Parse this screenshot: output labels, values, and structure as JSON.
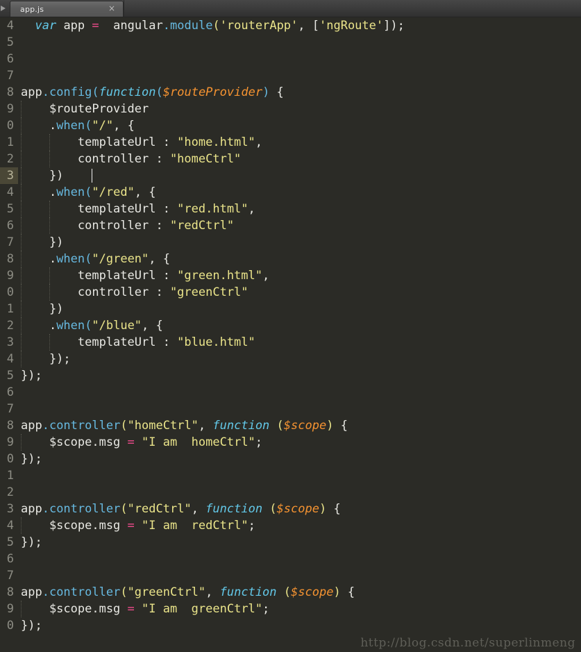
{
  "window": {
    "title": "app.js",
    "theme": "dark-monokai-like"
  },
  "tab_bar": {
    "scroll_left_icon": "triangle-left-icon",
    "tabs": [
      {
        "label": "app.js",
        "close_icon": "close-icon",
        "active": true
      }
    ]
  },
  "colors": {
    "background": "#2b2b26",
    "gutter_text": "#8d8d84",
    "current_line_gutter_bg": "#4a4736",
    "keyword": "#63c8e8",
    "method": "#67b9e0",
    "string": "#eae48a",
    "operator": "#ef4b8c",
    "variable": "#f59331",
    "plain": "#e8e8e3",
    "indent_guide": "#55554c",
    "tab_active_bg": "#5b5b5b",
    "tab_bar_bg": "#3a3a3a",
    "watermark": "#5f5f58"
  },
  "editor": {
    "language": "JavaScript",
    "current_line_number": "3",
    "caret": {
      "line_index": 9,
      "column": 10
    },
    "line_numbers": [
      "4",
      "5",
      "6",
      "7",
      "8",
      "9",
      "0",
      "1",
      "2",
      "3",
      "4",
      "5",
      "6",
      "7",
      "8",
      "9",
      "0",
      "1",
      "2",
      "3",
      "4",
      "5",
      "6",
      "7",
      "8",
      "9",
      "0",
      "1",
      "2",
      "3",
      "4",
      "5",
      "6",
      "7",
      "8",
      "9",
      "0"
    ],
    "lines": [
      {
        "num": "4",
        "tokens": [
          {
            "t": "  ",
            "c": "plain"
          },
          {
            "t": "var",
            "c": "kw"
          },
          {
            "t": " app ",
            "c": "plain"
          },
          {
            "t": "=",
            "c": "op"
          },
          {
            "t": "  ",
            "c": "plain"
          },
          {
            "t": "angular",
            "c": "plain"
          },
          {
            "t": ".module",
            "c": "method"
          },
          {
            "t": "(",
            "c": "punc-y"
          },
          {
            "t": "'routerApp'",
            "c": "str"
          },
          {
            "t": ", [",
            "c": "plain"
          },
          {
            "t": "'ngRoute'",
            "c": "str"
          },
          {
            "t": "]);",
            "c": "plain"
          }
        ]
      },
      {
        "num": "5",
        "tokens": []
      },
      {
        "num": "6",
        "tokens": []
      },
      {
        "num": "7",
        "tokens": []
      },
      {
        "num": "8",
        "tokens": [
          {
            "t": "app",
            "c": "plain"
          },
          {
            "t": ".config",
            "c": "method"
          },
          {
            "t": "(",
            "c": "punc-b"
          },
          {
            "t": "function",
            "c": "fn"
          },
          {
            "t": "(",
            "c": "punc-b"
          },
          {
            "t": "$routeProvider",
            "c": "var"
          },
          {
            "t": ")",
            "c": "punc-b"
          },
          {
            "t": " {",
            "c": "plain"
          }
        ]
      },
      {
        "num": "9",
        "tokens": [
          {
            "t": "    $routeProvider",
            "c": "plain"
          }
        ]
      },
      {
        "num": "0",
        "tokens": [
          {
            "t": "    .",
            "c": "plain"
          },
          {
            "t": "when",
            "c": "method"
          },
          {
            "t": "(",
            "c": "punc-b"
          },
          {
            "t": "\"/\"",
            "c": "str"
          },
          {
            "t": ", {",
            "c": "plain"
          }
        ]
      },
      {
        "num": "1",
        "tokens": [
          {
            "t": "        templateUrl : ",
            "c": "plain"
          },
          {
            "t": "\"home.html\"",
            "c": "str"
          },
          {
            "t": ",",
            "c": "plain"
          }
        ]
      },
      {
        "num": "2",
        "tokens": [
          {
            "t": "        controller : ",
            "c": "plain"
          },
          {
            "t": "\"homeCtrl\"",
            "c": "str"
          }
        ]
      },
      {
        "num": "3",
        "current": true,
        "tokens": [
          {
            "t": "    })",
            "c": "plain"
          }
        ]
      },
      {
        "num": "4",
        "tokens": [
          {
            "t": "    .",
            "c": "plain"
          },
          {
            "t": "when",
            "c": "method"
          },
          {
            "t": "(",
            "c": "punc-b"
          },
          {
            "t": "\"/red\"",
            "c": "str"
          },
          {
            "t": ", {",
            "c": "plain"
          }
        ]
      },
      {
        "num": "5",
        "tokens": [
          {
            "t": "        templateUrl : ",
            "c": "plain"
          },
          {
            "t": "\"red.html\"",
            "c": "str"
          },
          {
            "t": ",",
            "c": "plain"
          }
        ]
      },
      {
        "num": "6",
        "tokens": [
          {
            "t": "        controller : ",
            "c": "plain"
          },
          {
            "t": "\"redCtrl\"",
            "c": "str"
          }
        ]
      },
      {
        "num": "7",
        "tokens": [
          {
            "t": "    })",
            "c": "plain"
          }
        ]
      },
      {
        "num": "8",
        "tokens": [
          {
            "t": "    .",
            "c": "plain"
          },
          {
            "t": "when",
            "c": "method"
          },
          {
            "t": "(",
            "c": "punc-b"
          },
          {
            "t": "\"/green\"",
            "c": "str"
          },
          {
            "t": ", {",
            "c": "plain"
          }
        ]
      },
      {
        "num": "9",
        "tokens": [
          {
            "t": "        templateUrl : ",
            "c": "plain"
          },
          {
            "t": "\"green.html\"",
            "c": "str"
          },
          {
            "t": ",",
            "c": "plain"
          }
        ]
      },
      {
        "num": "0",
        "tokens": [
          {
            "t": "        controller : ",
            "c": "plain"
          },
          {
            "t": "\"greenCtrl\"",
            "c": "str"
          }
        ]
      },
      {
        "num": "1",
        "tokens": [
          {
            "t": "    })",
            "c": "plain"
          }
        ]
      },
      {
        "num": "2",
        "tokens": [
          {
            "t": "    .",
            "c": "plain"
          },
          {
            "t": "when",
            "c": "method"
          },
          {
            "t": "(",
            "c": "punc-b"
          },
          {
            "t": "\"/blue\"",
            "c": "str"
          },
          {
            "t": ", {",
            "c": "plain"
          }
        ]
      },
      {
        "num": "3",
        "tokens": [
          {
            "t": "        templateUrl : ",
            "c": "plain"
          },
          {
            "t": "\"blue.html\"",
            "c": "str"
          }
        ]
      },
      {
        "num": "4",
        "tokens": [
          {
            "t": "    });",
            "c": "plain"
          }
        ]
      },
      {
        "num": "5",
        "tokens": [
          {
            "t": "});",
            "c": "plain"
          }
        ]
      },
      {
        "num": "6",
        "tokens": []
      },
      {
        "num": "7",
        "tokens": []
      },
      {
        "num": "8",
        "tokens": [
          {
            "t": "app",
            "c": "plain"
          },
          {
            "t": ".controller",
            "c": "method"
          },
          {
            "t": "(",
            "c": "punc-y"
          },
          {
            "t": "\"homeCtrl\"",
            "c": "str"
          },
          {
            "t": ", ",
            "c": "plain"
          },
          {
            "t": "function",
            "c": "fn"
          },
          {
            "t": " (",
            "c": "punc-y"
          },
          {
            "t": "$scope",
            "c": "var"
          },
          {
            "t": ")",
            "c": "punc-y"
          },
          {
            "t": " {",
            "c": "plain"
          }
        ]
      },
      {
        "num": "9",
        "tokens": [
          {
            "t": "    $scope.msg ",
            "c": "plain"
          },
          {
            "t": "=",
            "c": "op"
          },
          {
            "t": " ",
            "c": "plain"
          },
          {
            "t": "\"I am  homeCtrl\"",
            "c": "str"
          },
          {
            "t": ";",
            "c": "plain"
          }
        ]
      },
      {
        "num": "0",
        "tokens": [
          {
            "t": "});",
            "c": "plain"
          }
        ]
      },
      {
        "num": "1",
        "tokens": []
      },
      {
        "num": "2",
        "tokens": []
      },
      {
        "num": "3",
        "tokens": [
          {
            "t": "app",
            "c": "plain"
          },
          {
            "t": ".controller",
            "c": "method"
          },
          {
            "t": "(",
            "c": "punc-y"
          },
          {
            "t": "\"redCtrl\"",
            "c": "str"
          },
          {
            "t": ", ",
            "c": "plain"
          },
          {
            "t": "function",
            "c": "fn"
          },
          {
            "t": " (",
            "c": "punc-y"
          },
          {
            "t": "$scope",
            "c": "var"
          },
          {
            "t": ")",
            "c": "punc-y"
          },
          {
            "t": " {",
            "c": "plain"
          }
        ]
      },
      {
        "num": "4",
        "tokens": [
          {
            "t": "    $scope.msg ",
            "c": "plain"
          },
          {
            "t": "=",
            "c": "op"
          },
          {
            "t": " ",
            "c": "plain"
          },
          {
            "t": "\"I am  redCtrl\"",
            "c": "str"
          },
          {
            "t": ";",
            "c": "plain"
          }
        ]
      },
      {
        "num": "5",
        "tokens": [
          {
            "t": "});",
            "c": "plain"
          }
        ]
      },
      {
        "num": "6",
        "tokens": []
      },
      {
        "num": "7",
        "tokens": []
      },
      {
        "num": "8",
        "tokens": [
          {
            "t": "app",
            "c": "plain"
          },
          {
            "t": ".controller",
            "c": "method"
          },
          {
            "t": "(",
            "c": "punc-y"
          },
          {
            "t": "\"greenCtrl\"",
            "c": "str"
          },
          {
            "t": ", ",
            "c": "plain"
          },
          {
            "t": "function",
            "c": "fn"
          },
          {
            "t": " (",
            "c": "punc-y"
          },
          {
            "t": "$scope",
            "c": "var"
          },
          {
            "t": ")",
            "c": "punc-y"
          },
          {
            "t": " {",
            "c": "plain"
          }
        ]
      },
      {
        "num": "9",
        "tokens": [
          {
            "t": "    $scope.msg ",
            "c": "plain"
          },
          {
            "t": "=",
            "c": "op"
          },
          {
            "t": " ",
            "c": "plain"
          },
          {
            "t": "\"I am  greenCtrl\"",
            "c": "str"
          },
          {
            "t": ";",
            "c": "plain"
          }
        ]
      },
      {
        "num": "0",
        "tokens": [
          {
            "t": "});",
            "c": "plain"
          }
        ]
      }
    ]
  },
  "watermark": {
    "text": "http://blog.csdn.net/superlinmeng"
  }
}
